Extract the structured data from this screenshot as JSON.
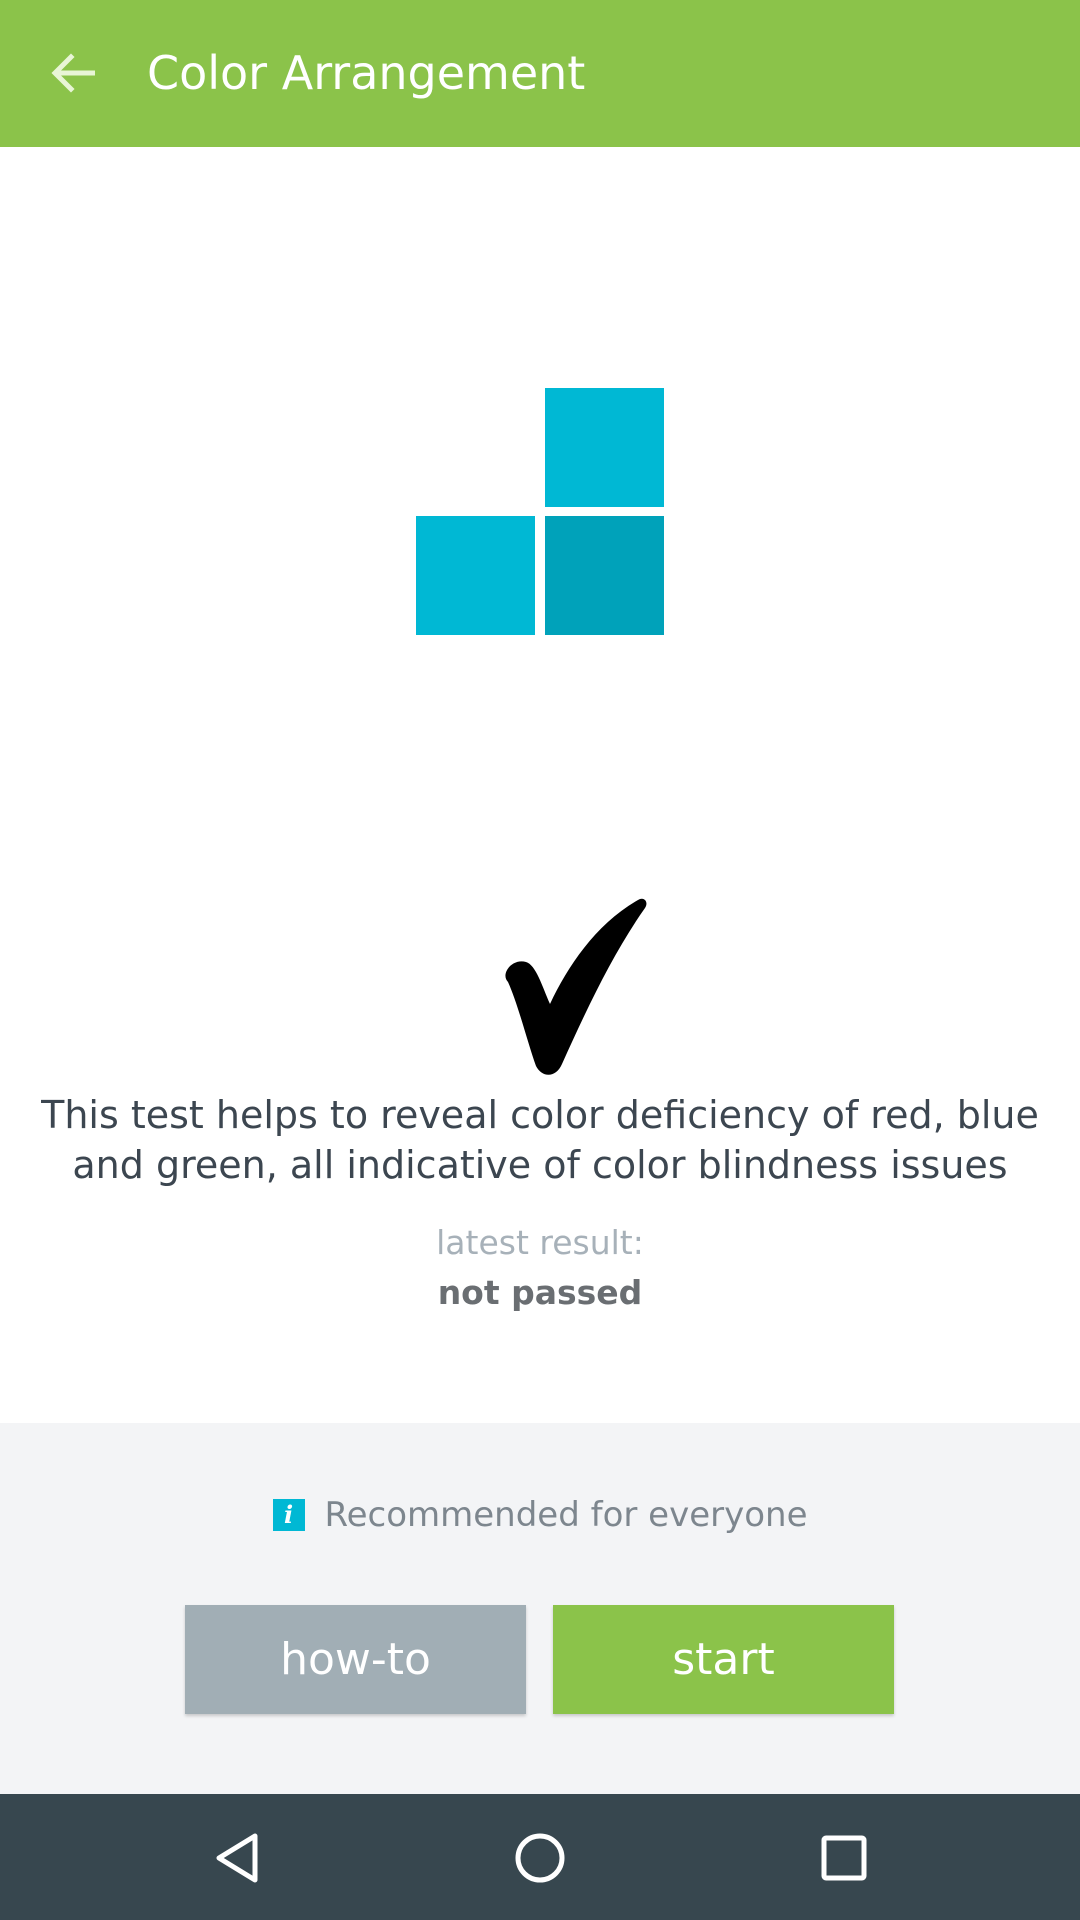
{
  "app_bar": {
    "title": "Color Arrangement",
    "back_icon": "arrow-back-icon",
    "background": "#8bc34a"
  },
  "main": {
    "description": "This test helps to reveal color deficiency of red, blue and green, all indicative of color blindness issues",
    "latest_result_label": "latest result:",
    "latest_result_value": "not passed",
    "illustration_colors": [
      "#00b8d4",
      "#00b8d4",
      "#00a2ba"
    ]
  },
  "bottom": {
    "recommendation": "Recommended for everyone",
    "info_icon_glyph": "i",
    "howto_label": "how-to",
    "start_label": "start"
  },
  "nav": {
    "back_icon": "nav-back-icon",
    "home_icon": "nav-home-icon",
    "recents_icon": "nav-recents-icon"
  }
}
